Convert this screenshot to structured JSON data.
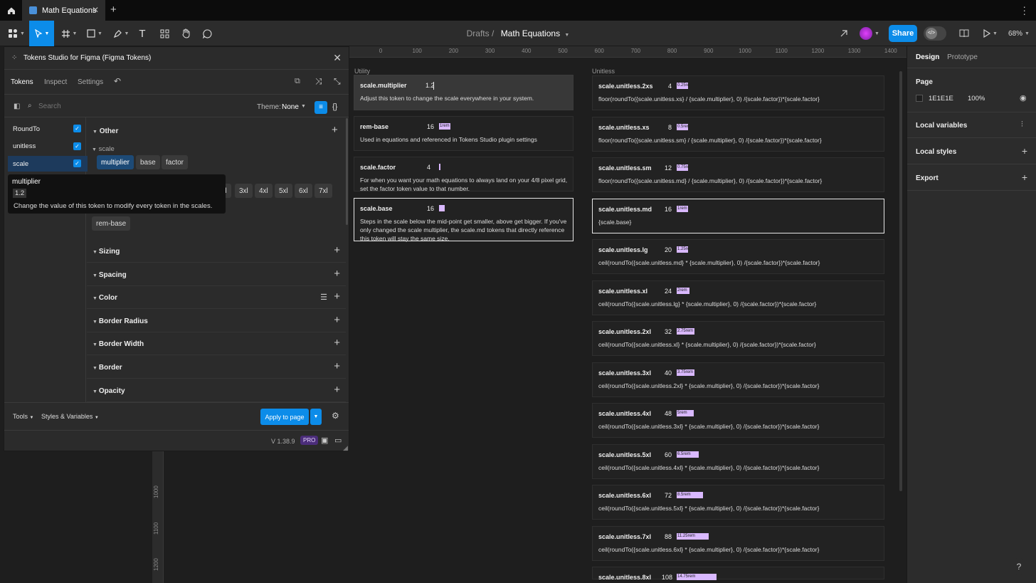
{
  "tabbar": {
    "tab_title": "Math Equations"
  },
  "toolbar": {
    "breadcrumb_parent": "Drafts",
    "breadcrumb_file": "Math Equations",
    "share_label": "Share",
    "zoom": "68%"
  },
  "rulers": {
    "h_ticks": [
      "0",
      "100",
      "200",
      "300",
      "400",
      "500",
      "600",
      "700",
      "800",
      "900",
      "1000",
      "1100",
      "1200",
      "1300",
      "1400"
    ],
    "v_ticks": [
      "1000",
      "1100",
      "1200"
    ]
  },
  "right_panel": {
    "tabs": [
      "Design",
      "Prototype"
    ],
    "page_label": "Page",
    "page_color": "1E1E1E",
    "page_opacity": "100%",
    "local_variables": "Local variables",
    "local_styles": "Local styles",
    "export": "Export"
  },
  "canvas": {
    "utility_heading": "Utility",
    "unitless_heading": "Unitless",
    "utility_cards": [
      {
        "name": "scale.multiplier",
        "value": "1.2",
        "desc": "Adjust this token to change the scale everywhere in your system."
      },
      {
        "name": "rem-base",
        "value": "16",
        "swatch": "1rem",
        "desc": "Used in equations and referenced in Tokens Studio plugin settings"
      },
      {
        "name": "scale.factor",
        "value": "4",
        "desc": "For when you want your math equations to always land on your 4/8 pixel grid, set the factor token value to that number."
      },
      {
        "name": "scale.base",
        "value": "16",
        "desc": "Steps in the scale below the mid-point get smaller, above get bigger. If you've only changed the scale multiplier, the scale.md tokens that directly reference this token will stay the same size."
      }
    ],
    "unitless_cards": [
      {
        "name": "scale.unitless.2xs",
        "value": "4",
        "swatch": "0.25rem",
        "desc": "floor(roundTo({scale.unitless.xs} / {scale.multiplier}, 0) /{scale.factor})*{scale.factor}"
      },
      {
        "name": "scale.unitless.xs",
        "value": "8",
        "swatch": "0.5rem",
        "desc": "floor(roundTo({scale.unitless.sm} / {scale.multiplier}, 0) /{scale.factor})*{scale.factor}"
      },
      {
        "name": "scale.unitless.sm",
        "value": "12",
        "swatch": "0.75rem",
        "desc": "floor(roundTo({scale.unitless.md} / {scale.multiplier}, 0) /{scale.factor})*{scale.factor}"
      },
      {
        "name": "scale.unitless.md",
        "value": "16",
        "swatch": "1rem",
        "desc": "{scale.base}"
      },
      {
        "name": "scale.unitless.lg",
        "value": "20",
        "swatch": "1.25rem",
        "desc": "ceil(roundTo({scale.unitless.md} * {scale.multiplier}, 0) /{scale.factor})*{scale.factor}"
      },
      {
        "name": "scale.unitless.xl",
        "value": "24",
        "swatch": "2rem",
        "desc": "ceil(roundTo({scale.unitless.lg} * {scale.multiplier}, 0) /{scale.factor})*{scale.factor}"
      },
      {
        "name": "scale.unitless.2xl",
        "value": "32",
        "swatch": "2.75rem",
        "desc": "ceil(roundTo({scale.unitless.xl} * {scale.multiplier}, 0) /{scale.factor})*{scale.factor}"
      },
      {
        "name": "scale.unitless.3xl",
        "value": "40",
        "swatch": "3.75rem",
        "desc": "ceil(roundTo({scale.unitless.2xl} * {scale.multiplier}, 0) /{scale.factor})*{scale.factor}"
      },
      {
        "name": "scale.unitless.4xl",
        "value": "48",
        "swatch": "5rem",
        "desc": "ceil(roundTo({scale.unitless.3xl} * {scale.multiplier}, 0) /{scale.factor})*{scale.factor}"
      },
      {
        "name": "scale.unitless.5xl",
        "value": "60",
        "swatch": "6.5rem",
        "desc": "ceil(roundTo({scale.unitless.4xl} * {scale.multiplier}, 0) /{scale.factor})*{scale.factor}"
      },
      {
        "name": "scale.unitless.6xl",
        "value": "72",
        "swatch": "8.5rem",
        "desc": "ceil(roundTo({scale.unitless.5xl} * {scale.multiplier}, 0) /{scale.factor})*{scale.factor}"
      },
      {
        "name": "scale.unitless.7xl",
        "value": "88",
        "swatch": "11.25rem",
        "desc": "ceil(roundTo({scale.unitless.6xl} * {scale.multiplier}, 0) /{scale.factor})*{scale.factor}"
      },
      {
        "name": "scale.unitless.8xl",
        "value": "108",
        "swatch": "14.75rem",
        "desc": ""
      }
    ]
  },
  "plugin": {
    "title": "Tokens Studio for Figma (Figma Tokens)",
    "tabs": [
      "Tokens",
      "Inspect",
      "Settings"
    ],
    "search_placeholder": "Search",
    "theme_label": "Theme:",
    "theme_value": "None",
    "token_sets": [
      {
        "name": "RoundTo",
        "checked": true
      },
      {
        "name": "unitless",
        "checked": true
      },
      {
        "name": "scale",
        "checked": true
      }
    ],
    "other_group": "Other",
    "scale_sub": "scale",
    "scale_pills": [
      "multiplier",
      "base",
      "factor"
    ],
    "size_pills": [
      "d",
      "3xl",
      "4xl",
      "5xl",
      "6xl",
      "7xl"
    ],
    "rem_pill": "rem-base",
    "groups": [
      "Sizing",
      "Spacing",
      "Color",
      "Border Radius",
      "Border Width",
      "Border",
      "Opacity"
    ],
    "tooltip": {
      "name": "multiplier",
      "value": "1.2",
      "desc": "Change the value of this token to modify every token in the scales."
    },
    "footer": {
      "tools": "Tools",
      "styles": "Styles & Variables",
      "apply": "Apply to page",
      "version": "V 1.38.9",
      "pro": "PRO"
    }
  }
}
